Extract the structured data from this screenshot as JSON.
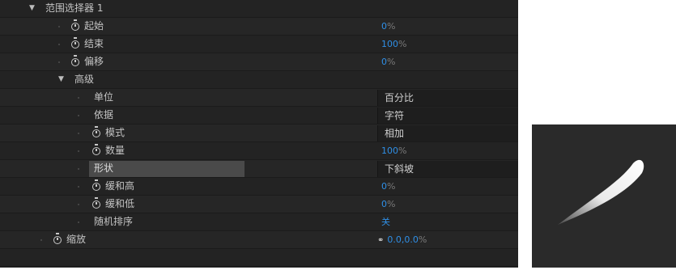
{
  "properties": {
    "range_selector": {
      "label": "范围选择器 1"
    },
    "start": {
      "label": "起始",
      "value": "0",
      "unit": "%"
    },
    "end": {
      "label": "结束",
      "value": "100",
      "unit": "%"
    },
    "offset": {
      "label": "偏移",
      "value": "0",
      "unit": "%"
    },
    "advanced": {
      "label": "高级"
    },
    "units": {
      "label": "单位",
      "value": "百分比"
    },
    "based_on": {
      "label": "依据",
      "value": "字符"
    },
    "mode": {
      "label": "模式",
      "value": "相加"
    },
    "amount": {
      "label": "数量",
      "value": "100",
      "unit": "%"
    },
    "shape": {
      "label": "形状",
      "value": "下斜坡"
    },
    "ease_high": {
      "label": "缓和高",
      "value": "0",
      "unit": "%"
    },
    "ease_low": {
      "label": "缓和低",
      "value": "0",
      "unit": "%"
    },
    "randomize": {
      "label": "随机排序",
      "value": "关"
    },
    "scale": {
      "label": "缩放",
      "value": "0.0,0.0",
      "unit": "%"
    }
  },
  "colors": {
    "panel_bg": "#232323",
    "value_blue": "#2f8fe6",
    "preview_bg": "#2a2a2a"
  },
  "icons": [
    "disclosure-triangle-icon",
    "stopwatch-icon",
    "constrain-link-icon"
  ]
}
